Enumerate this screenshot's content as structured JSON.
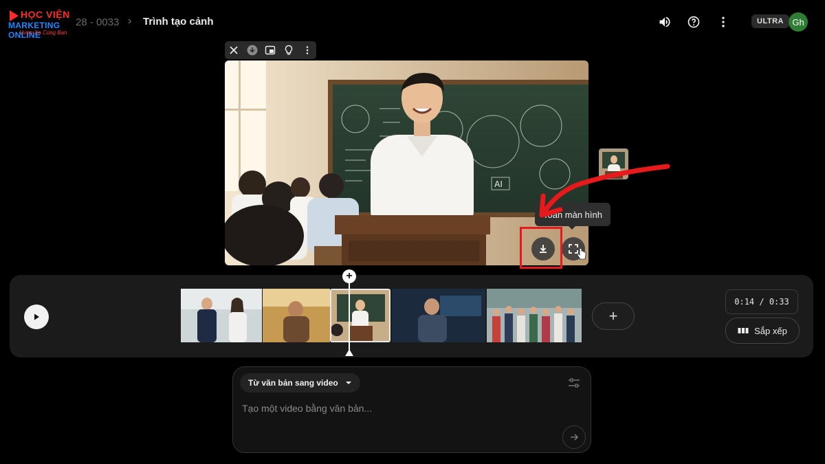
{
  "logo": {
    "line1": "HỌC VIỆN",
    "line2": "MARKETING ONLINE",
    "line3": "Vươn Xa Cùng Bạn"
  },
  "header": {
    "breadcrumb_id": "28 - 0033",
    "breadcrumb_sep": "›",
    "title": "Trình tạo cảnh",
    "icons": [
      "volume-icon",
      "help-icon",
      "more-vert-icon"
    ],
    "plan_badge": "ULTRA",
    "avatar_initials": "Gh"
  },
  "clip_toolbar": {
    "icons": [
      "close-icon",
      "download-circle-icon",
      "extend-clip-icon",
      "idea-bulb-icon",
      "more-vert-icon"
    ]
  },
  "preview": {
    "tooltip": "Toàn màn hình",
    "download_icon": "download-icon",
    "fullscreen_icon": "fullscreen-icon",
    "highlight_color": "#e8191b"
  },
  "timeline": {
    "timecode": "0:14 / 0:33",
    "arrange_label": "Sắp xếp",
    "add_label": "+",
    "playhead_add": "+",
    "clips": [
      "clip-interview",
      "clip-elder-field",
      "clip-teacher-classroom",
      "clip-man-studio",
      "clip-group-office"
    ],
    "selected_clip": 3
  },
  "prompt": {
    "mode_label": "Từ văn bản sang video",
    "placeholder": "Tạo một video bằng văn bản..."
  },
  "colors": {
    "background": "#000000",
    "panel": "#1b1b1b",
    "avatar": "#2e7d32",
    "annotation": "#e8191b"
  }
}
